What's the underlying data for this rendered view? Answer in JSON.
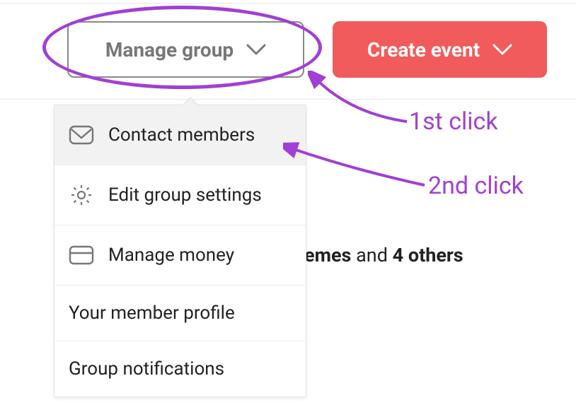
{
  "buttons": {
    "manage_label": "Manage group",
    "create_label": "Create event"
  },
  "dropdown": {
    "items": [
      {
        "label": "Contact members"
      },
      {
        "label": "Edit group settings"
      },
      {
        "label": "Manage money"
      },
      {
        "label": "Your member profile"
      },
      {
        "label": "Group notifications"
      }
    ]
  },
  "background": {
    "partial_word": "emes",
    "and": " and ",
    "others_count": "4 others"
  },
  "annotations": {
    "first": "1st click",
    "second": "2nd click"
  },
  "colors": {
    "accent_red": "#f25b5b",
    "annotation_purple": "#a23fd4",
    "border_gray": "#888"
  }
}
